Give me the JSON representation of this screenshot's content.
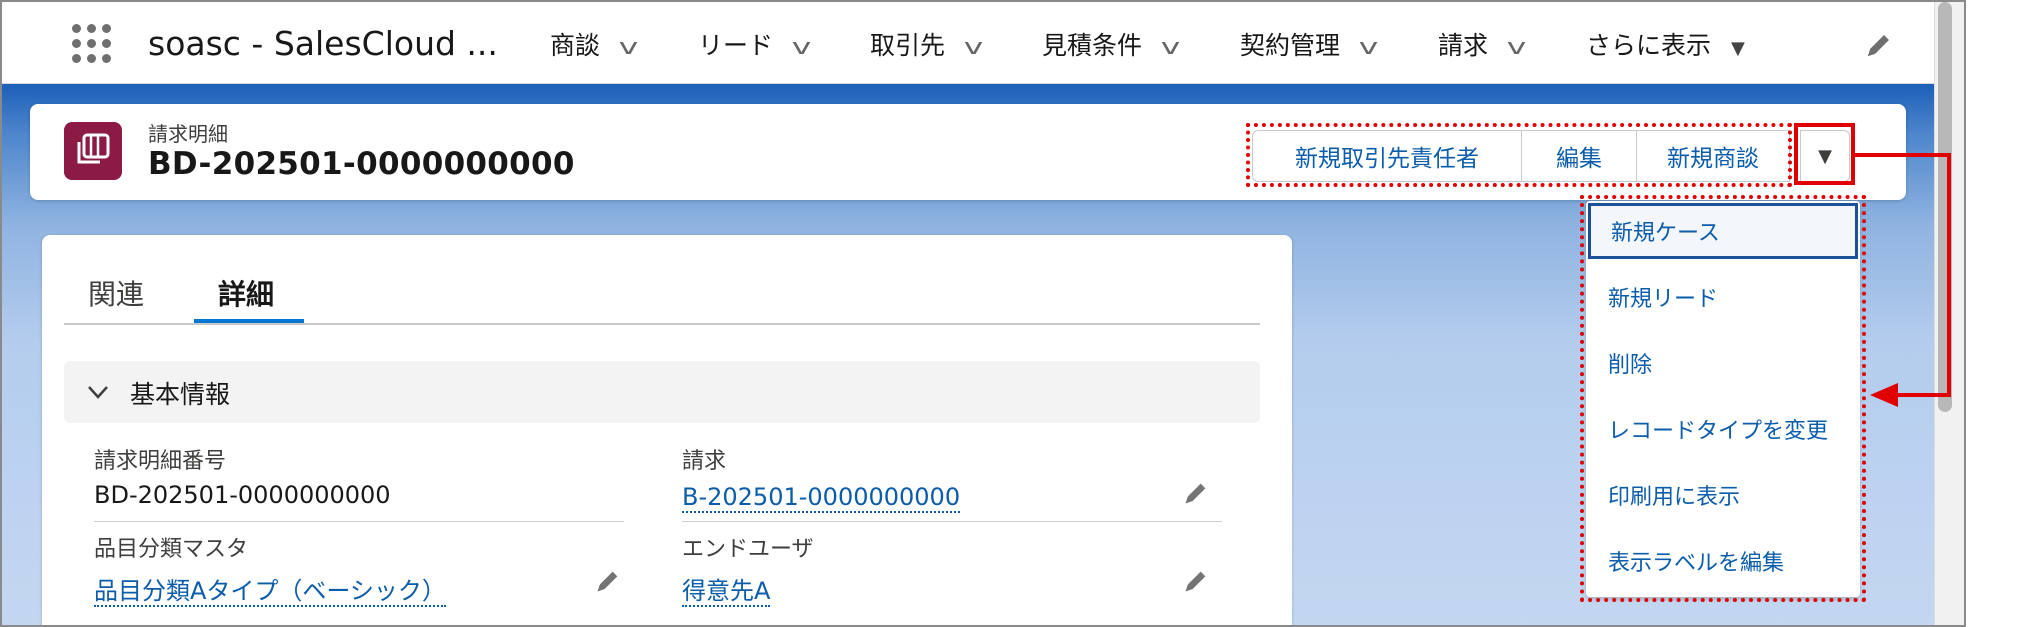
{
  "app": {
    "name": "soasc - SalesCloud ..."
  },
  "nav": {
    "items": [
      {
        "label": "商談"
      },
      {
        "label": "リード"
      },
      {
        "label": "取引先"
      },
      {
        "label": "見積条件"
      },
      {
        "label": "契約管理"
      },
      {
        "label": "請求"
      }
    ],
    "more_label": "さらに表示"
  },
  "record": {
    "type_label": "請求明細",
    "title": "BD-202501-0000000000"
  },
  "header_actions": [
    {
      "label": "新規取引先責任者"
    },
    {
      "label": "編集"
    },
    {
      "label": "新規商談"
    }
  ],
  "dropdown": {
    "items": [
      {
        "label": "新規ケース"
      },
      {
        "label": "新規リード"
      },
      {
        "label": "削除"
      },
      {
        "label": "レコードタイプを変更"
      },
      {
        "label": "印刷用に表示"
      },
      {
        "label": "表示ラベルを編集"
      }
    ]
  },
  "tabs": {
    "related": "関連",
    "detail": "詳細"
  },
  "section": {
    "title": "基本情報"
  },
  "fields": {
    "line_number": {
      "label": "請求明細番号",
      "value": "BD-202501-0000000000"
    },
    "invoice": {
      "label": "請求",
      "value": "B-202501-0000000000"
    },
    "item_class": {
      "label": "品目分類マスタ",
      "value": "品目分類Aタイプ（ベーシック）"
    },
    "end_user": {
      "label": "エンドユーザ",
      "value": "得意先A"
    }
  },
  "colors": {
    "brand_blue": "#0b5cab",
    "record_icon": "#8b1a44",
    "annotation_red": "#e00000"
  },
  "icons": [
    "app-launcher-icon",
    "chevron-down-icon",
    "caret-down-icon",
    "pencil-icon",
    "record-icon"
  ]
}
